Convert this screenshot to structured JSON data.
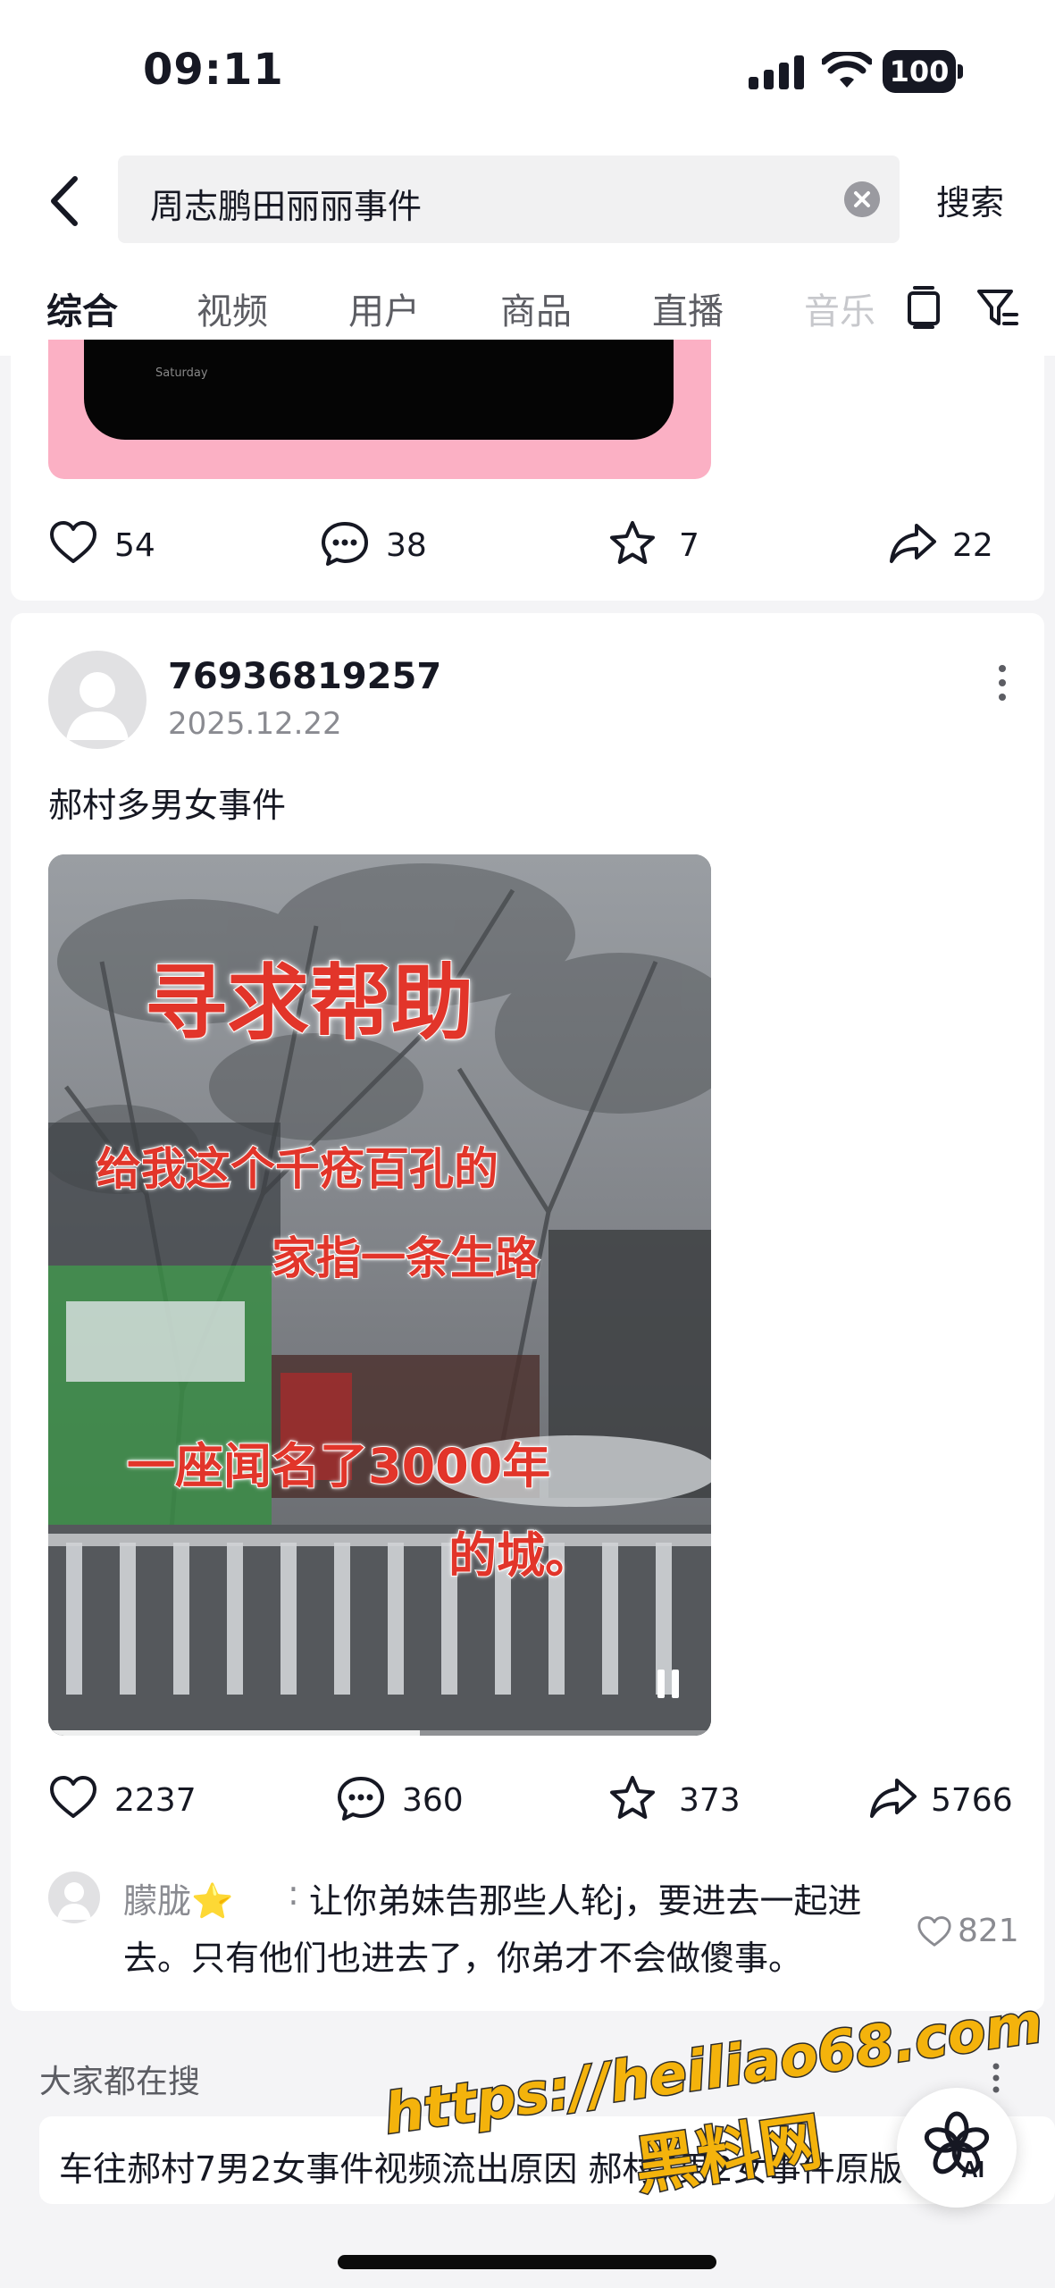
{
  "status_bar": {
    "time": "09:11",
    "battery": "100"
  },
  "search": {
    "query": "周志鹏田丽丽事件",
    "submit_label": "搜索"
  },
  "tabs": [
    {
      "label": "综合",
      "active": true
    },
    {
      "label": "视频"
    },
    {
      "label": "用户"
    },
    {
      "label": "商品"
    },
    {
      "label": "直播"
    },
    {
      "label": "音乐"
    }
  ],
  "post1": {
    "media_caption": "Saturday",
    "likes": "54",
    "comments": "38",
    "favorites": "7",
    "shares": "22"
  },
  "post2": {
    "username": "76936819257",
    "date": "2025.12.22",
    "text": "郝村多男女事件",
    "video_text": {
      "line1": "寻求帮助",
      "line2": "给我这个千疮百孔的",
      "line3": "家指一条生路",
      "line4": "一座闻名了3000年",
      "line5": "的城。"
    },
    "video_progress_fraction": 0.56,
    "likes": "2237",
    "comments": "360",
    "favorites": "373",
    "shares": "5766",
    "top_comment": {
      "user": "朦胧⭐",
      "line1": "让你弟妹告那些人轮j，要进去一起进",
      "line2": "去。只有他们也进去了，你弟才不会做傻事。",
      "likes": "821"
    }
  },
  "hot_search": {
    "title": "大家都在搜",
    "chip": "车往郝村7男2女事件视频流出原因    郝村7男2女事件原版视频"
  },
  "watermark": {
    "url": "https://heiliao68.com",
    "name": "黑料网"
  },
  "ai_button": {
    "label": "AI"
  },
  "colors": {
    "accent_red": "#e2352a",
    "pink": "#fbb0c4",
    "watermark_yellow": "#f4b30c"
  }
}
